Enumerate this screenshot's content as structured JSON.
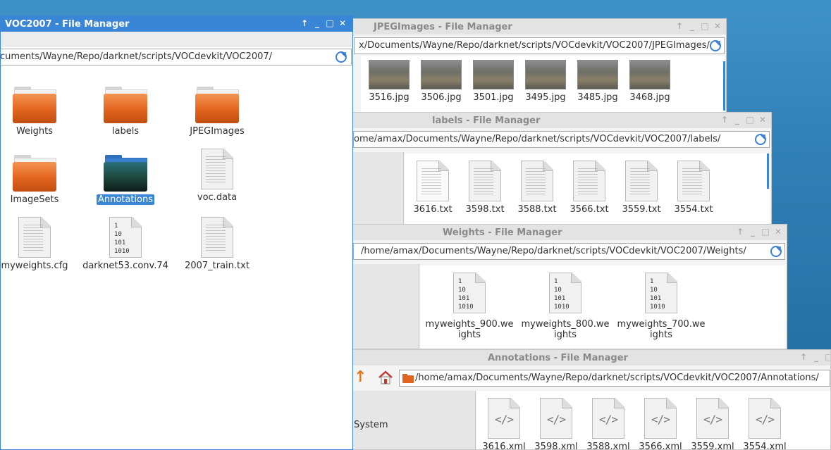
{
  "windows": {
    "voc2007": {
      "title": "VOC2007 - File Manager",
      "path": "cuments/Wayne/Repo/darknet/scripts/VOCdevkit/VOC2007/",
      "items": [
        {
          "label": "Weights"
        },
        {
          "label": "labels"
        },
        {
          "label": "JPEGImages"
        },
        {
          "label": "ImageSets"
        },
        {
          "label": "Annotations"
        },
        {
          "label": "voc.data"
        },
        {
          "label": "myweights.cfg"
        },
        {
          "label": "darknet53.conv.74"
        },
        {
          "label": "2007_train.txt"
        }
      ],
      "binary_glyph": [
        "1",
        "10",
        "101",
        "1010"
      ]
    },
    "jpegimages": {
      "title": "JPEGImages - File Manager",
      "path": "x/Documents/Wayne/Repo/darknet/scripts/VOCdevkit/VOC2007/JPEGImages/",
      "items": [
        "3516.jpg",
        "3506.jpg",
        "3501.jpg",
        "3495.jpg",
        "3485.jpg",
        "3468.jpg"
      ]
    },
    "labels": {
      "title": "labels - File Manager",
      "path": "ome/amax/Documents/Wayne/Repo/darknet/scripts/VOCdevkit/VOC2007/labels/",
      "items": [
        "3616.txt",
        "3598.txt",
        "3588.txt",
        "3566.txt",
        "3559.txt",
        "3554.txt"
      ]
    },
    "weights": {
      "title": "Weights - File Manager",
      "path": "/home/amax/Documents/Wayne/Repo/darknet/scripts/VOCdevkit/VOC2007/Weights/",
      "items": [
        {
          "line1": "myweights_900.we",
          "line2": "ights"
        },
        {
          "line1": "myweights_800.we",
          "line2": "ights"
        },
        {
          "line1": "myweights_700.we",
          "line2": "ights"
        }
      ]
    },
    "annotations": {
      "title": "Annotations - File Manager",
      "path": "/home/amax/Documents/Wayne/Repo/darknet/scripts/VOCdevkit/VOC2007/Annotations/",
      "sidebar_item": "System",
      "code_glyph": "</>",
      "items": [
        "3616.xml",
        "3598.xml",
        "3588.xml",
        "3566.xml",
        "3559.xml",
        "3554.xml"
      ]
    }
  },
  "controls": {
    "up": "↑",
    "min": "_",
    "max": "□",
    "close": "✕"
  },
  "colors": {
    "accent": "#3a86d6",
    "folder_orange": "#e2641e",
    "desktop_blue": "#2f7fb6"
  }
}
